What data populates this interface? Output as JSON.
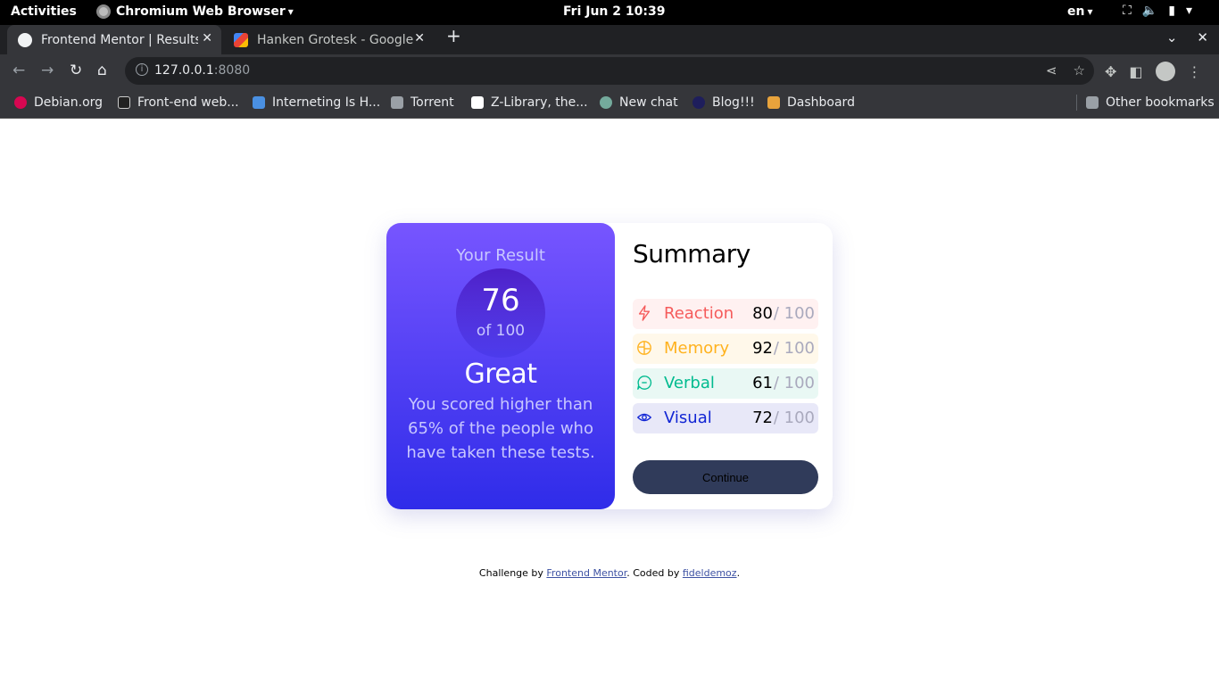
{
  "system": {
    "activities": "Activities",
    "app_name": "Chromium Web Browser",
    "clock": "Fri Jun 2  10:39",
    "lang": "en"
  },
  "tabs": [
    {
      "title": "Frontend Mentor | Results summary component"
    },
    {
      "title": "Hanken Grotesk - Google Fonts"
    }
  ],
  "omnibox": {
    "host": "127.0.0.1",
    "port": ":8080"
  },
  "bookmarks": [
    {
      "label": "Debian.org",
      "color": "#d70751"
    },
    {
      "label": "Front-end web...",
      "color": "#222222"
    },
    {
      "label": "Interneting Is H...",
      "color": "#4a90e2"
    },
    {
      "label": "Torrent",
      "color": "#9aa0a6"
    },
    {
      "label": "Z-Library, the...",
      "color": "#ffffff"
    },
    {
      "label": "New chat",
      "color": "#74aa9c"
    },
    {
      "label": "Blog!!!",
      "color": "#1e1e5c"
    },
    {
      "label": "Dashboard",
      "color": "#e8a33c"
    }
  ],
  "other_bookmarks": "Other bookmarks",
  "result": {
    "heading": "Your Result",
    "score": "76",
    "of": "of 100",
    "grade": "Great",
    "description": "You scored higher than 65% of the people who have taken these tests."
  },
  "summary": {
    "title": "Summary",
    "rows": [
      {
        "label": "Reaction",
        "value": "80",
        "max": "/ 100",
        "icon": "lightning-icon",
        "color": "#f55b5b"
      },
      {
        "label": "Memory",
        "value": "92",
        "max": "/ 100",
        "icon": "brain-icon",
        "color": "#ffb21e"
      },
      {
        "label": "Verbal",
        "value": "61",
        "max": "/ 100",
        "icon": "chat-icon",
        "color": "#00bb8f"
      },
      {
        "label": "Visual",
        "value": "72",
        "max": "/ 100",
        "icon": "eye-icon",
        "color": "#1125d4"
      }
    ],
    "continue_label": "Continue"
  },
  "attribution": {
    "prefix": "Challenge by ",
    "link1": "Frontend Mentor",
    "middle": ". Coded by ",
    "link2": "fideldemoz",
    "suffix": "."
  }
}
